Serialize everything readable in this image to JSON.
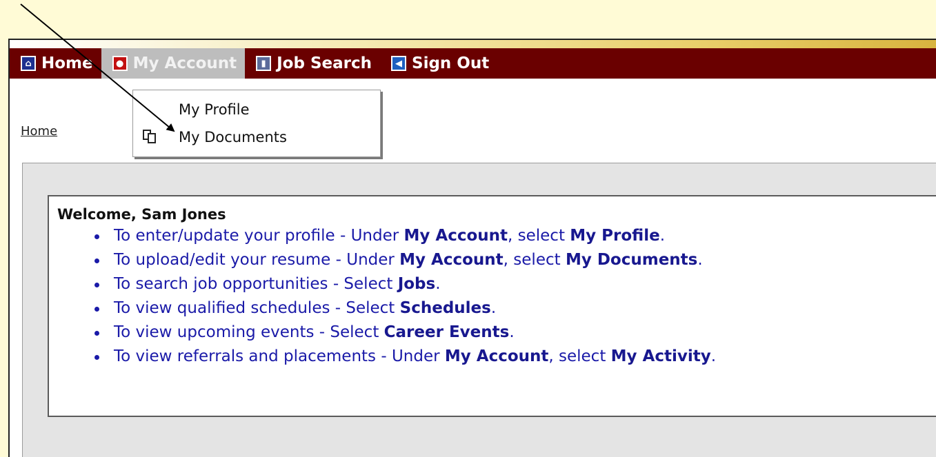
{
  "nav": {
    "home_label": "Home",
    "account_label": "My Account",
    "job_label": "Job Search",
    "signout_label": "Sign Out"
  },
  "dropdown": {
    "items": [
      {
        "label": "My Profile"
      },
      {
        "label": "My Documents"
      }
    ]
  },
  "breadcrumb": {
    "label": "Home"
  },
  "welcome": {
    "title": "Welcome, Sam Jones",
    "items": [
      {
        "pre": "To enter/update your profile - Under ",
        "b1": "My Account",
        "mid": ", select ",
        "b2": "My Profile",
        "post": "."
      },
      {
        "pre": "To upload/edit your resume - Under ",
        "b1": "My Account",
        "mid": ", select ",
        "b2": "My Documents",
        "post": "."
      },
      {
        "pre": "To search job opportunities - Select ",
        "b1": "Jobs",
        "mid": "",
        "b2": "",
        "post": "."
      },
      {
        "pre": "To view qualified schedules - Select ",
        "b1": "Schedules",
        "mid": "",
        "b2": "",
        "post": "."
      },
      {
        "pre": "To view upcoming events - Select ",
        "b1": "Career Events",
        "mid": "",
        "b2": "",
        "post": "."
      },
      {
        "pre": "To view referrals and placements - Under ",
        "b1": "My Account",
        "mid": ", select ",
        "b2": "My Activity",
        "post": "."
      }
    ]
  },
  "colors": {
    "nav_background": "#6a0000",
    "link_blue": "#1a1aa8",
    "page_background": "#fffbd6"
  },
  "icons": {
    "home": "home-icon",
    "account": "account-icon",
    "job": "job-search-icon",
    "signout": "sign-out-icon",
    "documents": "documents-icon"
  }
}
